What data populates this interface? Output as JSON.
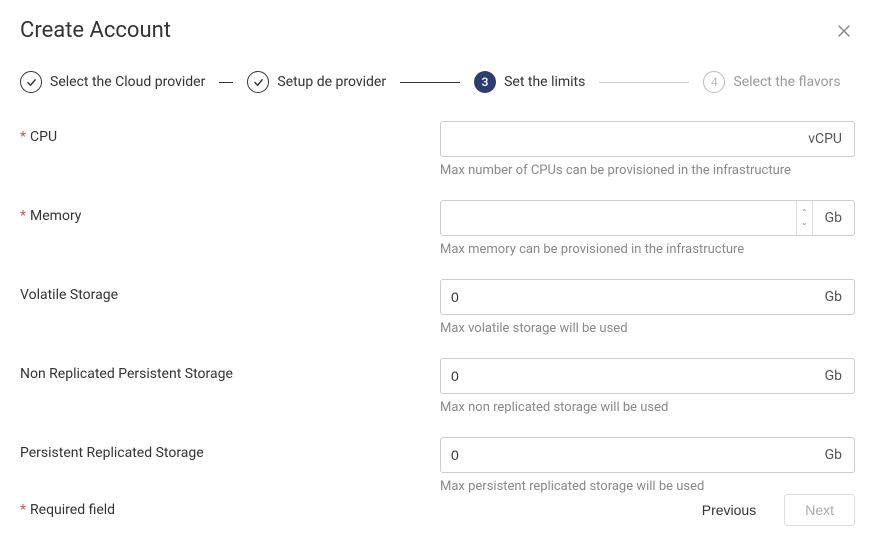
{
  "title": "Create Account",
  "stepper": {
    "steps": [
      {
        "label": "Select the Cloud provider",
        "state": "completed"
      },
      {
        "label": "Setup de provider",
        "state": "completed"
      },
      {
        "label": "Set the limits",
        "state": "active",
        "number": "3"
      },
      {
        "label": "Select the flavors",
        "state": "upcoming",
        "number": "4"
      }
    ]
  },
  "fields": {
    "cpu": {
      "label": "CPU",
      "required": true,
      "value": "",
      "unit": "vCPU",
      "hint": "Max number of CPUs can be provisioned in the infrastructure"
    },
    "memory": {
      "label": "Memory",
      "required": true,
      "value": "",
      "unit": "Gb",
      "hint": "Max memory can be provisioned in the infrastructure"
    },
    "volatile": {
      "label": "Volatile Storage",
      "required": false,
      "value": "0",
      "unit": "Gb",
      "hint": "Max volatile storage will be used"
    },
    "nonreplicated": {
      "label": "Non Replicated Persistent Storage",
      "required": false,
      "value": "0",
      "unit": "Gb",
      "hint": "Max non replicated storage will be used"
    },
    "replicated": {
      "label": "Persistent Replicated Storage",
      "required": false,
      "value": "0",
      "unit": "Gb",
      "hint": "Max persistent replicated storage will be used"
    }
  },
  "footer": {
    "required_note": "Required field",
    "previous": "Previous",
    "next": "Next"
  }
}
